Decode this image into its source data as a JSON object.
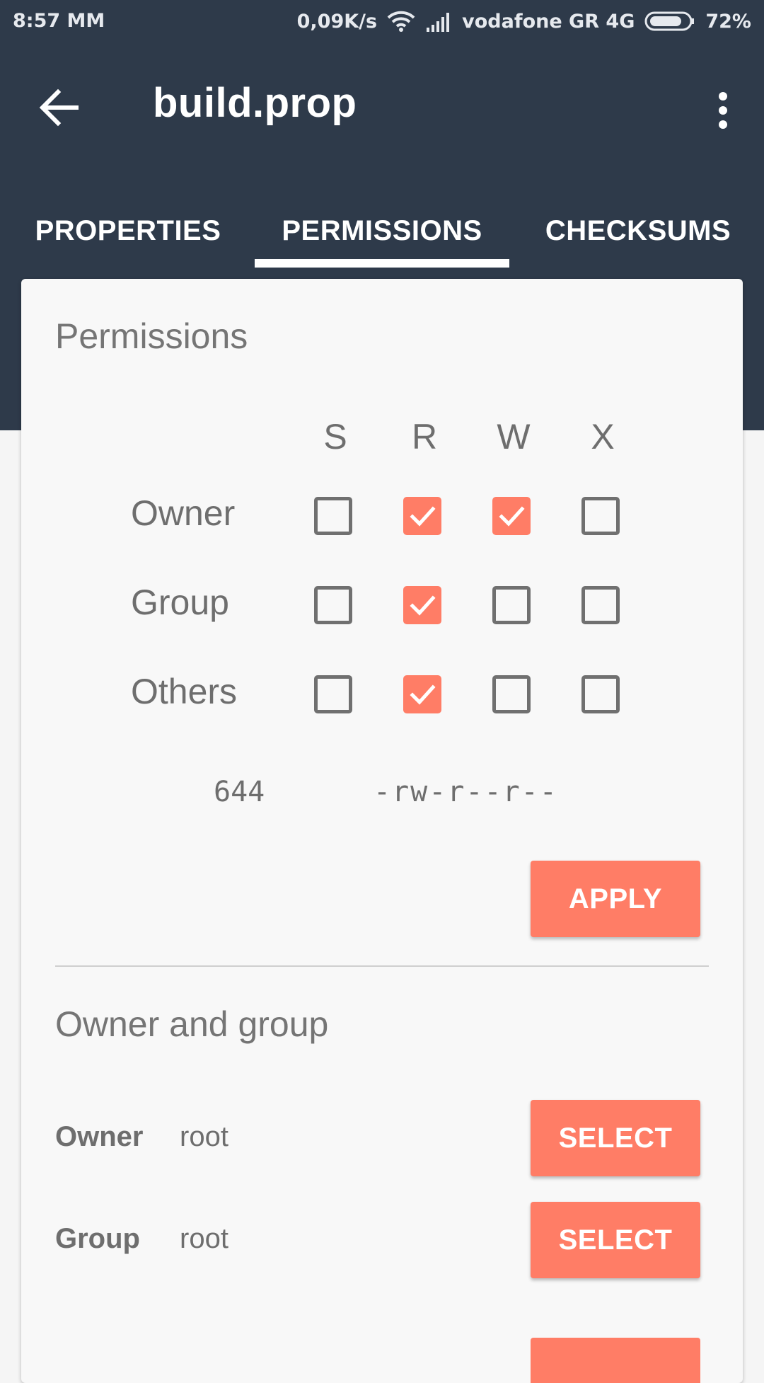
{
  "status_bar": {
    "time": "8:57 MM",
    "network_speed": "0,09K/s",
    "carrier": "vodafone GR 4G",
    "battery": "72%"
  },
  "app_bar": {
    "title": "build.prop",
    "back_icon": "arrow-left-icon",
    "more_icon": "more-vert-icon"
  },
  "tabs": [
    {
      "label": "PROPERTIES",
      "active": false
    },
    {
      "label": "PERMISSIONS",
      "active": true
    },
    {
      "label": "CHECKSUMS",
      "active": false
    }
  ],
  "permissions": {
    "title": "Permissions",
    "columns": [
      "S",
      "R",
      "W",
      "X"
    ],
    "rows": [
      {
        "label": "Owner",
        "checks": [
          false,
          true,
          true,
          false
        ]
      },
      {
        "label": "Group",
        "checks": [
          false,
          true,
          false,
          false
        ]
      },
      {
        "label": "Others",
        "checks": [
          false,
          true,
          false,
          false
        ]
      }
    ],
    "octal": "644",
    "symbolic": "-rw-r--r--",
    "apply_label": "APPLY"
  },
  "owner_group": {
    "title": "Owner and group",
    "owner_label": "Owner",
    "owner_value": "root",
    "group_label": "Group",
    "group_value": "root",
    "select_label": "SELECT"
  },
  "colors": {
    "app_bar": "#2e3a4a",
    "accent": "#ff7d66",
    "text_secondary": "#6e6e6e"
  }
}
